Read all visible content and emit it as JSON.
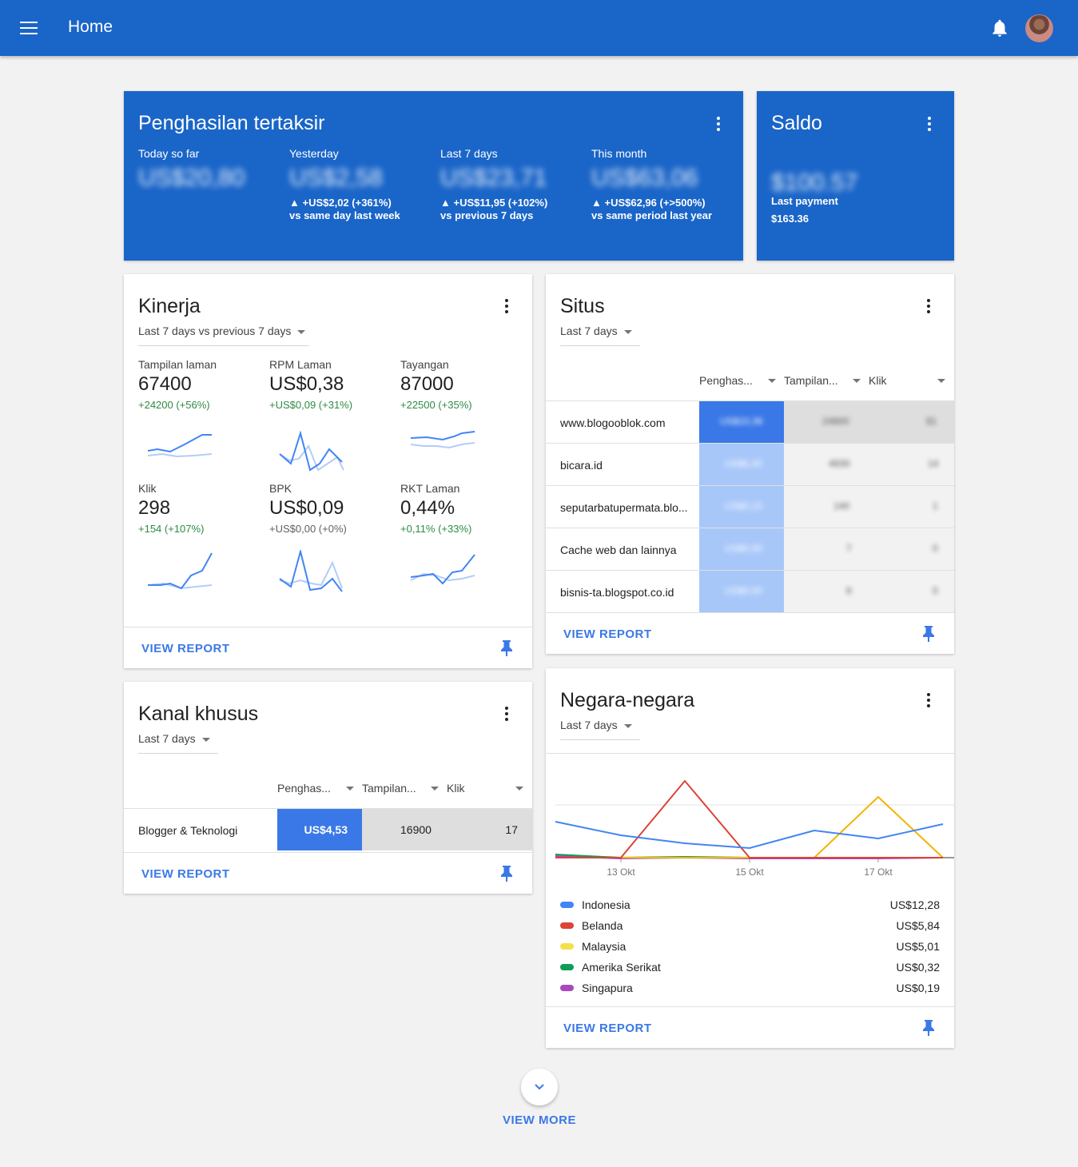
{
  "appbar": {
    "title": "Home"
  },
  "earnings": {
    "title": "Penghasilan tertaksir",
    "stats": [
      {
        "label": "Today so far",
        "value": "US$20,80",
        "change": "",
        "compare": ""
      },
      {
        "label": "Yesterday",
        "value": "US$2,58",
        "change": "▲ +US$2,02 (+361%)",
        "compare": "vs same day last week"
      },
      {
        "label": "Last 7 days",
        "value": "US$23,71",
        "change": "▲ +US$11,95 (+102%)",
        "compare": "vs previous 7 days"
      },
      {
        "label": "This month",
        "value": "US$63,06",
        "change": "▲ +US$62,96 (+>500%)",
        "compare": "vs same period last year"
      }
    ]
  },
  "saldo": {
    "title": "Saldo",
    "value": "$100.57",
    "last_payment_label": "Last payment",
    "last_payment_value": "$163.36"
  },
  "kinerja": {
    "title": "Kinerja",
    "range": "Last 7 days vs previous 7 days",
    "metrics": [
      {
        "label": "Tampilan laman",
        "value": "67400",
        "change": "+24200 (+56%)"
      },
      {
        "label": "RPM Laman",
        "value": "US$0,38",
        "change": "+US$0,09 (+31%)"
      },
      {
        "label": "Tayangan",
        "value": "87000",
        "change": "+22500 (+35%)"
      },
      {
        "label": "Klik",
        "value": "298",
        "change": "+154 (+107%)"
      },
      {
        "label": "BPK",
        "value": "US$0,09",
        "change": "+US$0,00 (+0%)"
      },
      {
        "label": "RKT Laman",
        "value": "0,44%",
        "change": "+0,11% (+33%)"
      }
    ],
    "footer": "VIEW REPORT"
  },
  "situs": {
    "title": "Situs",
    "range": "Last 7 days",
    "columns": [
      "Penghas...",
      "Tampilan...",
      "Klik"
    ],
    "rows": [
      {
        "name": "www.blogooblok.com",
        "earn": "US$10,36",
        "views": "24800",
        "clicks": "81"
      },
      {
        "name": "bicara.id",
        "earn": "US$6,43",
        "views": "4930",
        "clicks": "14"
      },
      {
        "name": "seputarbatupermata.blo...",
        "earn": "US$0,15",
        "views": "140",
        "clicks": "1"
      },
      {
        "name": "Cache web dan lainnya",
        "earn": "US$0,00",
        "views": "7",
        "clicks": "0"
      },
      {
        "name": "bisnis-ta.blogspot.co.id",
        "earn": "US$0,00",
        "views": "6",
        "clicks": "0"
      }
    ],
    "footer": "VIEW REPORT"
  },
  "kanal": {
    "title": "Kanal khusus",
    "range": "Last 7 days",
    "columns": [
      "Penghas...",
      "Tampilan...",
      "Klik"
    ],
    "rows": [
      {
        "name": "Blogger & Teknologi",
        "earn": "US$4,53",
        "views": "16900",
        "clicks": "17"
      }
    ],
    "footer": "VIEW REPORT"
  },
  "negara": {
    "title": "Negara-negara",
    "range": "Last 7 days",
    "x_labels": [
      "13 Okt",
      "15 Okt",
      "17 Okt"
    ],
    "legend": [
      {
        "name": "Indonesia",
        "value": "US$12,28",
        "color": "#4285f4"
      },
      {
        "name": "Belanda",
        "value": "US$5,84",
        "color": "#db4437"
      },
      {
        "name": "Malaysia",
        "value": "US$5,01",
        "color": "#f4e04d"
      },
      {
        "name": "Amerika Serikat",
        "value": "US$0,32",
        "color": "#0f9d58"
      },
      {
        "name": "Singapura",
        "value": "US$0,19",
        "color": "#ab47bc"
      }
    ],
    "footer": "VIEW REPORT"
  },
  "view_more": "VIEW MORE",
  "colors": {
    "appbar": "#1a65c8",
    "accent": "#3b78e7",
    "positive": "#2e8b45"
  },
  "icons": [
    "menu-icon",
    "bell-icon",
    "more-vert-icon",
    "pin-icon",
    "chevron-down-icon"
  ]
}
